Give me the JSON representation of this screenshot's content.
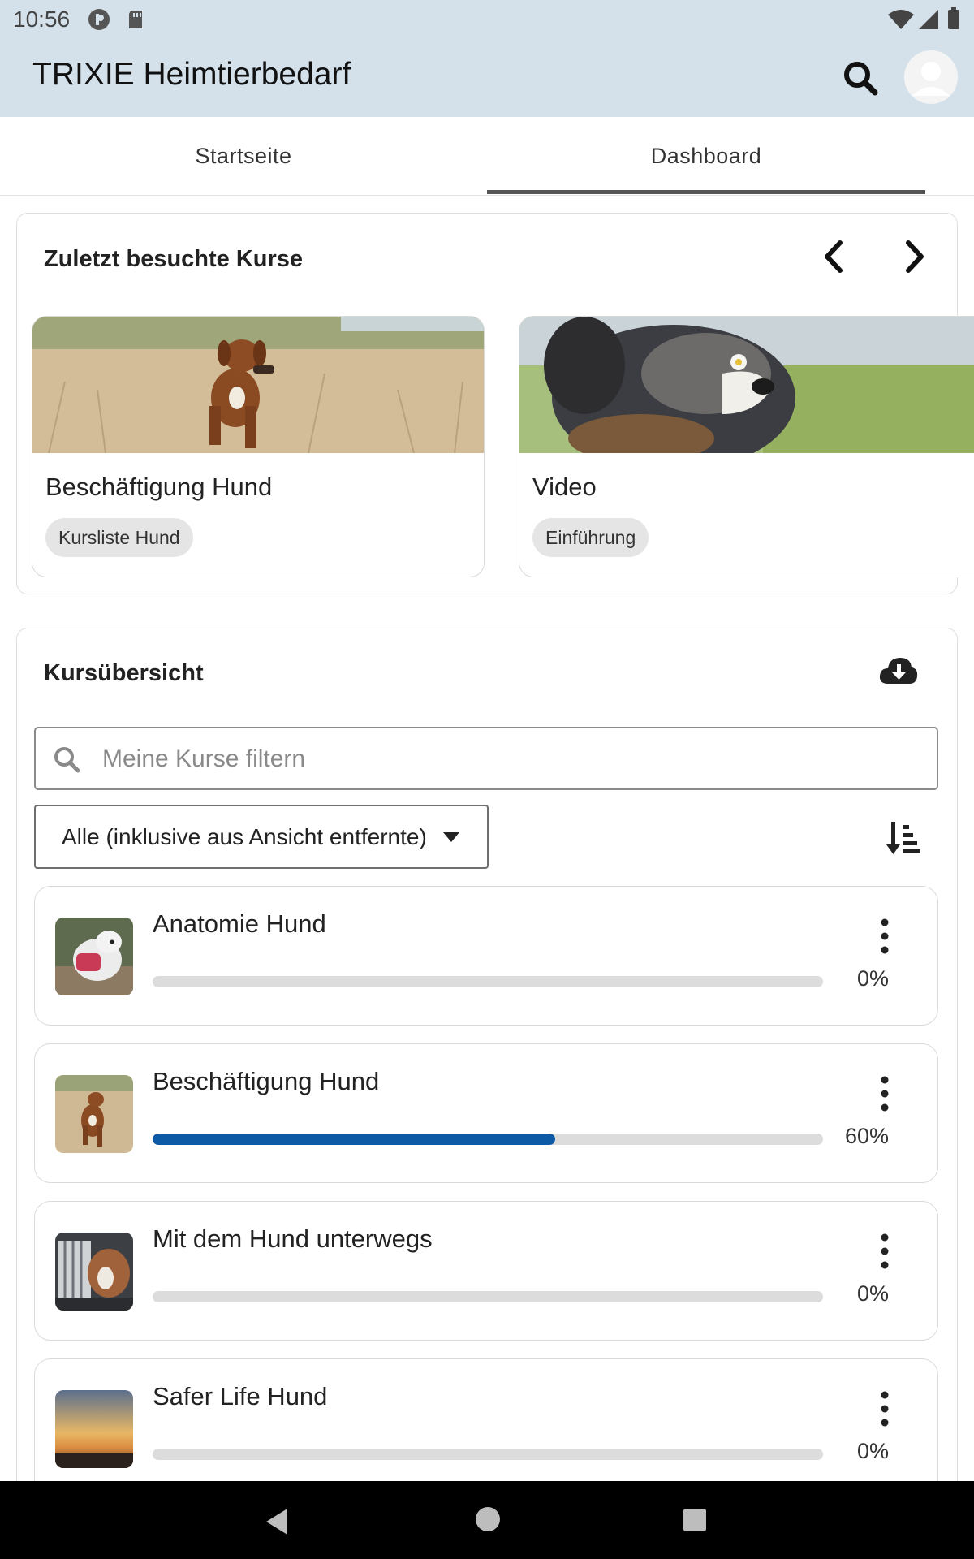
{
  "status_bar": {
    "time": "10:56"
  },
  "app_bar": {
    "title": "TRIXIE Heimtierbedarf"
  },
  "tabs": [
    {
      "label": "Startseite",
      "active": false
    },
    {
      "label": "Dashboard",
      "active": true
    }
  ],
  "recent_courses": {
    "title": "Zuletzt besuchte Kurse",
    "cards": [
      {
        "name": "Beschäftigung Hund",
        "chip": "Kursliste Hund"
      },
      {
        "name": "Video",
        "chip": "Einführung"
      }
    ]
  },
  "overview": {
    "title": "Kursübersicht",
    "search_placeholder": "Meine Kurse filtern",
    "filter_selected": "Alle (inklusive aus Ansicht entfernte)",
    "courses": [
      {
        "title": "Anatomie Hund",
        "progress": 0,
        "percent_label": "0%"
      },
      {
        "title": "Beschäftigung Hund",
        "progress": 60,
        "percent_label": "60%"
      },
      {
        "title": "Mit dem Hund unterwegs",
        "progress": 0,
        "percent_label": "0%"
      },
      {
        "title": "Safer Life Hund",
        "progress": 0,
        "percent_label": "0%"
      }
    ]
  },
  "colors": {
    "appbar_bg": "#d4e1ea",
    "progress_fill": "#0c5aa6",
    "progress_track": "#dcdcdc",
    "chip_bg": "#e5e5e5"
  }
}
